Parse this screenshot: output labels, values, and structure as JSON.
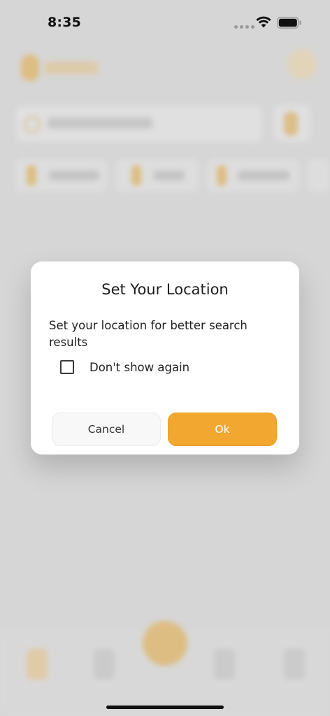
{
  "status_bar": {
    "time": "8:35"
  },
  "dialog": {
    "title": "Set Your Location",
    "message": "Set your location for better search results",
    "checkbox_label": "Don't show again",
    "cancel_label": "Cancel",
    "ok_label": "Ok"
  },
  "colors": {
    "accent": "#f2a730",
    "dialog_background": "#ffffff",
    "screen_dim": "#d9d9d9"
  },
  "icons": {
    "signal": "signal-dots-icon",
    "wifi": "wifi-icon",
    "battery": "battery-icon",
    "checkbox": "checkbox-unchecked-icon"
  }
}
